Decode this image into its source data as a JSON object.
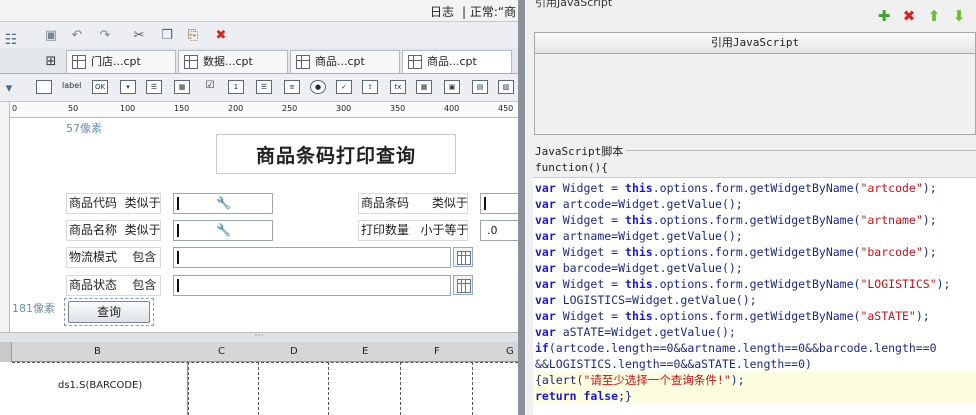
{
  "topbar": {
    "log": "日志",
    "mode": "| 正常:“商"
  },
  "tabs": [
    {
      "label": "门店...cpt"
    },
    {
      "label": "数据...cpt"
    },
    {
      "label": "商品...cpt"
    },
    {
      "label": "商品...cpt"
    }
  ],
  "widget_icons": {
    "label": "label",
    "ok": "OK",
    "tx": "tx"
  },
  "ruler": {
    "ticks": [
      "0",
      "50",
      "100",
      "150",
      "200",
      "250",
      "300",
      "350",
      "400",
      "450"
    ]
  },
  "form": {
    "px_top": "57像素",
    "px_left": "181像素",
    "title": "商品条码打印查询",
    "rows": [
      {
        "label": "商品代码  类似于"
      },
      {
        "label": "商品名称  类似于"
      },
      {
        "label": "物流模式    包含"
      },
      {
        "label": "商品状态    包含"
      }
    ],
    "right_rows": [
      {
        "label": "商品条码      类似于",
        "value": ""
      },
      {
        "label": "打印数量   小于等于",
        "value": ".0"
      }
    ],
    "query_label": "查询"
  },
  "grid": {
    "columns": [
      "B",
      "C",
      "D",
      "E",
      "F",
      "G"
    ],
    "cell_b": "ds1.S(BARCODE)"
  },
  "right": {
    "header": "引用JavaScript",
    "ref_bar": "引用JavaScript",
    "js_label": "JavaScript脚本",
    "function_line": "function(){",
    "code_lines": [
      [
        {
          "t": "var",
          "c": "kw"
        },
        {
          "t": " Widget = "
        },
        {
          "t": "this",
          "c": "kw"
        },
        {
          "t": ".options.form.getWidgetByName("
        },
        {
          "t": "\"artcode\"",
          "c": "st"
        },
        {
          "t": ");"
        }
      ],
      [
        {
          "t": "var",
          "c": "kw"
        },
        {
          "t": " artcode=Widget.getValue();"
        }
      ],
      [
        {
          "t": "var",
          "c": "kw"
        },
        {
          "t": " Widget = "
        },
        {
          "t": "this",
          "c": "kw"
        },
        {
          "t": ".options.form.getWidgetByName("
        },
        {
          "t": "\"artname\"",
          "c": "st"
        },
        {
          "t": ");"
        }
      ],
      [
        {
          "t": "var",
          "c": "kw"
        },
        {
          "t": " artname=Widget.getValue();"
        }
      ],
      [
        {
          "t": "var",
          "c": "kw"
        },
        {
          "t": " Widget = "
        },
        {
          "t": "this",
          "c": "kw"
        },
        {
          "t": ".options.form.getWidgetByName("
        },
        {
          "t": "\"barcode\"",
          "c": "st"
        },
        {
          "t": ");"
        }
      ],
      [
        {
          "t": "var",
          "c": "kw"
        },
        {
          "t": " barcode=Widget.getValue();"
        }
      ],
      [
        {
          "t": "var",
          "c": "kw"
        },
        {
          "t": " Widget = "
        },
        {
          "t": "this",
          "c": "kw"
        },
        {
          "t": ".options.form.getWidgetByName("
        },
        {
          "t": "\"LOGISTICS\"",
          "c": "st"
        },
        {
          "t": ");"
        }
      ],
      [
        {
          "t": "var",
          "c": "kw"
        },
        {
          "t": " LOGISTICS=Widget.getValue();"
        }
      ],
      [
        {
          "t": "var",
          "c": "kw"
        },
        {
          "t": " Widget = "
        },
        {
          "t": "this",
          "c": "kw"
        },
        {
          "t": ".options.form.getWidgetByName("
        },
        {
          "t": "\"aSTATE\"",
          "c": "st"
        },
        {
          "t": ");"
        }
      ],
      [
        {
          "t": "var",
          "c": "kw"
        },
        {
          "t": " aSTATE=Widget.getValue();"
        }
      ],
      [
        {
          "t": "if",
          "c": "kw"
        },
        {
          "t": "(artcode.length==0&&artname.length==0&&barcode.length==0"
        }
      ],
      [
        {
          "t": "&&LOGISTICS.length==0&&aSTATE.length==0)"
        }
      ],
      [
        {
          "t": "{alert("
        },
        {
          "t": "\"请至少选择一个查询条件!\"",
          "c": "st"
        },
        {
          "t": ");"
        }
      ],
      [
        {
          "t": "return",
          "c": "kw"
        },
        {
          "t": " "
        },
        {
          "t": "false",
          "c": "kw"
        },
        {
          "t": ";}"
        }
      ]
    ]
  },
  "colors": {
    "keyword": "#1b1bc4",
    "string": "#c1131c",
    "add": "#3aa52b",
    "delete": "#d8201d",
    "move": "#6cc02a"
  }
}
